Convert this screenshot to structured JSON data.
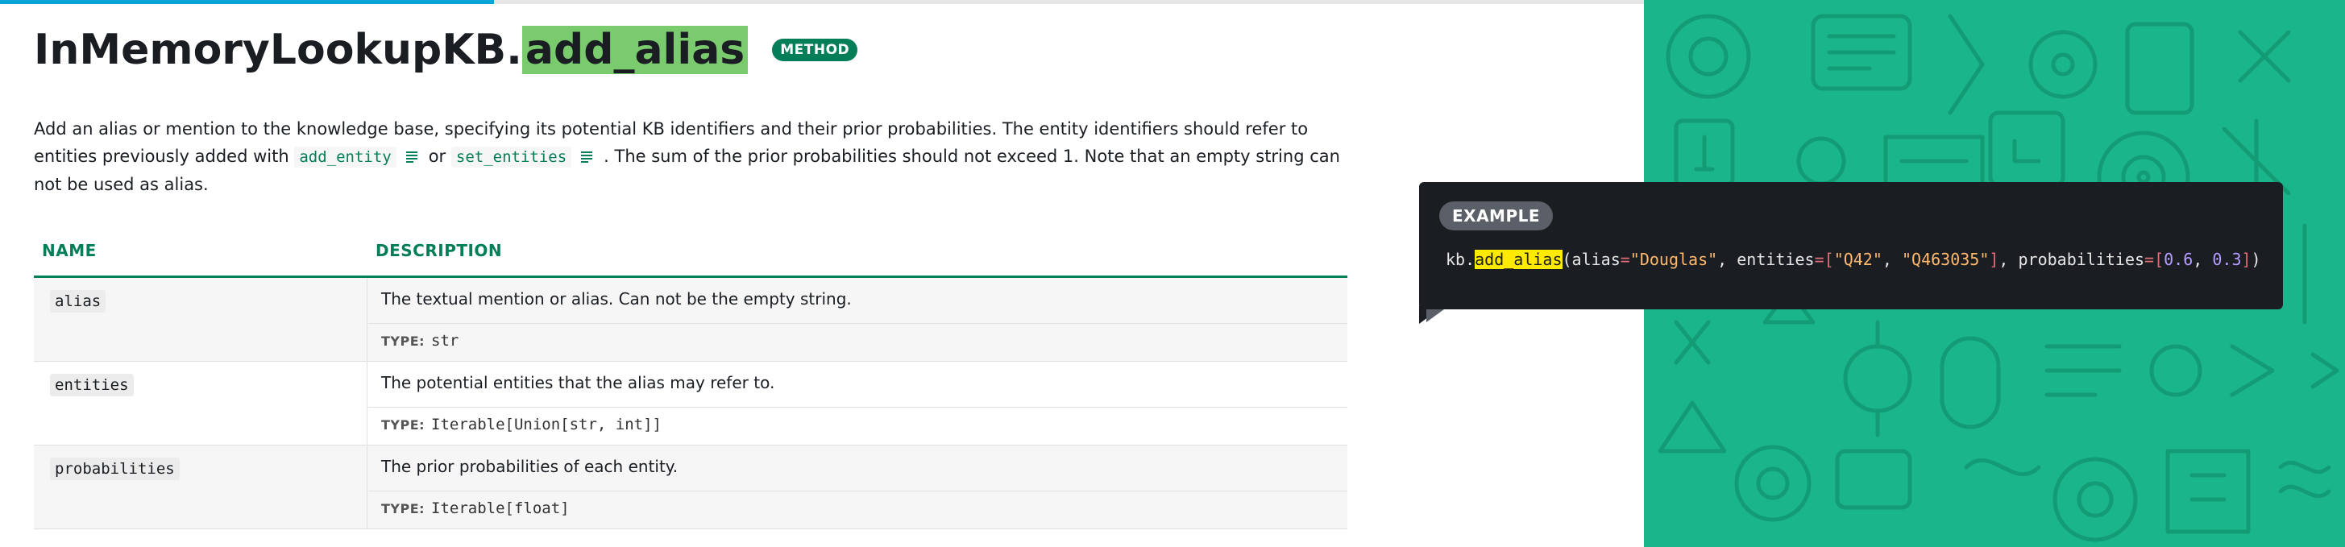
{
  "progress": {
    "fraction": 0.3
  },
  "heading": {
    "prefix": "InMemoryLookupKB.",
    "highlight": "add_alias",
    "tag": "METHOD"
  },
  "description": {
    "part1": "Add an alias or mention to the knowledge base, specifying its potential KB identifiers and their prior probabilities. The entity identifiers should refer to entities previously added with ",
    "code1": "add_entity",
    "part2": "or",
    "code2": "set_entities",
    "part3": ". The sum of the prior probabilities should not exceed 1. Note that an empty string can not be used as alias."
  },
  "table": {
    "headers": {
      "name": "NAME",
      "description": "DESCRIPTION"
    },
    "type_label": "TYPE:",
    "rows": [
      {
        "name": "alias",
        "description": "The textual mention or alias. Can not be the empty string.",
        "type": "str"
      },
      {
        "name": "entities",
        "description": "The potential entities that the alias may refer to.",
        "type": "Iterable[Union[str, int]]"
      },
      {
        "name": "probabilities",
        "description": "The prior probabilities of each entity.",
        "type": "Iterable[float]"
      }
    ]
  },
  "example": {
    "label": "EXAMPLE",
    "code": {
      "obj": "kb.",
      "method": "add_alias",
      "open": "(alias",
      "eq1": "=",
      "alias_val": "\"Douglas\"",
      "sep1": ", entities",
      "eq2": "=",
      "lb1": "[",
      "ent1": "\"Q42\"",
      "sep2": ", ",
      "ent2": "\"Q463035\"",
      "rb1": "]",
      "sep3": ", probabilities",
      "eq3": "=",
      "lb2": "[",
      "p1": "0.6",
      "sep4": ", ",
      "p2": "0.3",
      "rb2": "]",
      "close": ")"
    }
  },
  "colors": {
    "accent": "#047e58",
    "highlight": "#79cb6e",
    "panel": "#1bb58b",
    "code_bg": "#1a1e23",
    "code_highlight": "#ffea00"
  },
  "icons": {
    "doc": "doc-lines-icon"
  }
}
